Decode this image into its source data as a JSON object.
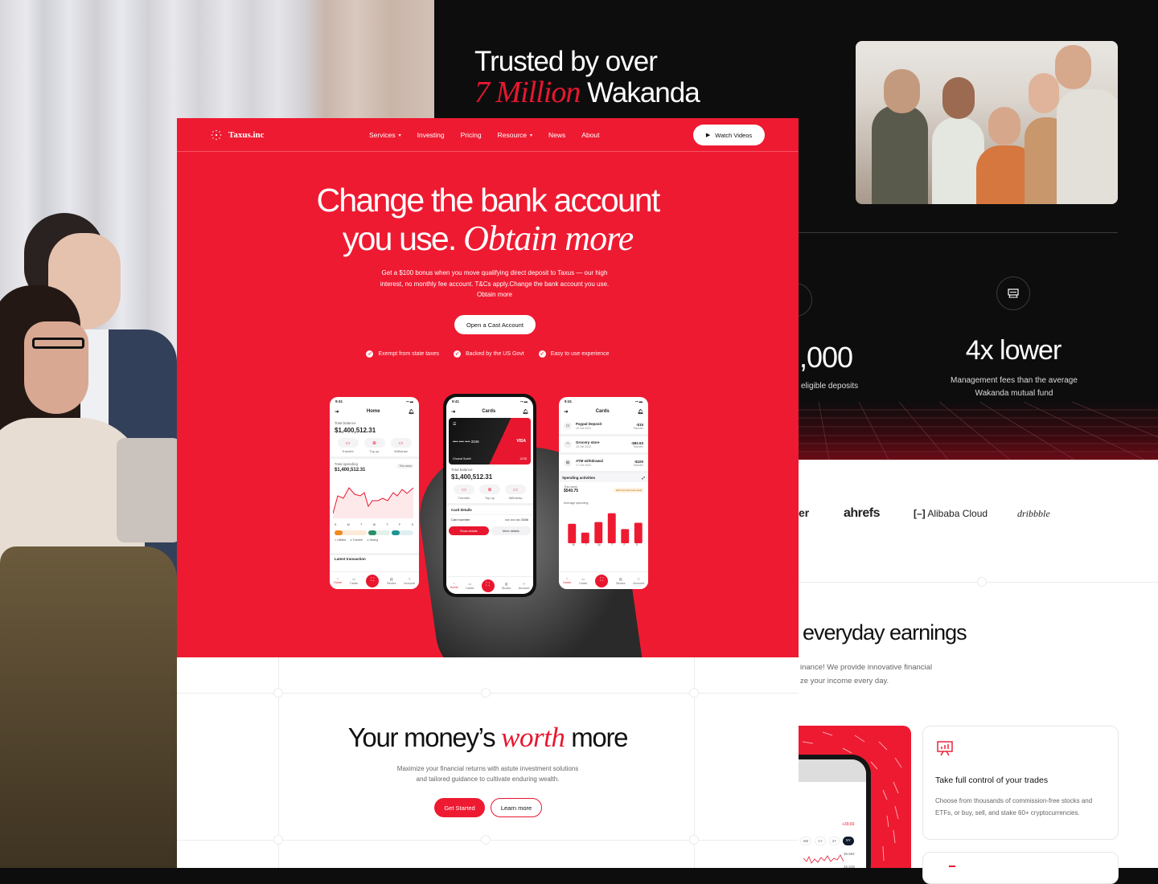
{
  "background_panels": {
    "dark": {
      "trusted_line1": "Trusted by over",
      "trusted_highlight": "7 Million",
      "trusted_line2_rest": "Wakanda",
      "team_photo_alt": "group-of-friends-celebrating",
      "stats": [
        {
          "value": ",000",
          "caption": "eligible deposits",
          "icon": "wallet-icon"
        },
        {
          "value": "4x lower",
          "caption_line1": "Management fees than the average",
          "caption_line2": "Wakanda mutual fund",
          "icon": "cash-register-icon"
        }
      ]
    },
    "white": {
      "partner_logos": [
        "er",
        "ahrefs",
        "Alibaba Cloud",
        "dribbble"
      ],
      "earnings_title": "everyday earnings",
      "earnings_sub_line1": "inance! We provide innovative financial",
      "earnings_sub_line2": "ze your income every day.",
      "trade_card": {
        "icon": "presentation-chart-icon",
        "title": "Take full control of your trades",
        "body": "Choose from thousands of commission-free stocks and ETFs, or buy, sell, and stake 60+ cryptocurrencies."
      },
      "phone_snippet": {
        "change": "+39,60",
        "ranges": [
          "6M",
          "1Y",
          "2Y",
          "5Y"
        ],
        "active_range": "5Y",
        "levels": [
          "36.682",
          "32.219"
        ]
      }
    }
  },
  "site": {
    "brand": "Taxus.inc",
    "nav": [
      {
        "label": "Services",
        "dropdown": true
      },
      {
        "label": "Investing",
        "dropdown": false
      },
      {
        "label": "Pricing",
        "dropdown": false
      },
      {
        "label": "Resource",
        "dropdown": true
      },
      {
        "label": "News",
        "dropdown": false
      },
      {
        "label": "About",
        "dropdown": false
      }
    ],
    "watch_button": "Watch Videos",
    "hero": {
      "title_line1": "Change the bank account",
      "title_line2_plain": "you use.",
      "title_line2_italic": "Obtain more",
      "subtitle": "Get a $100 bonus when you move qualifying direct deposit to Taxus — our high interest, no monthly fee account. T&Cs apply.Change the bank account you use. Obtain more",
      "cta": "Open a Cast Account",
      "checks": [
        "Exempt from state taxes",
        "Backed by the US Govt",
        "Easy to use experience"
      ]
    },
    "phones": {
      "time": "9:41",
      "home": {
        "title": "Home",
        "total_balance_label": "Total balance",
        "total_balance": "$1,400,512.31",
        "actions": [
          "Transfer",
          "Top up",
          "Withdraw"
        ],
        "spending_label": "Total spending",
        "spending_value": "$1,400,512.31",
        "period": "This week",
        "days": [
          "S",
          "M",
          "T",
          "W",
          "T",
          "F",
          "S"
        ],
        "legend": [
          "Utilities",
          "Transfer",
          "Saving"
        ],
        "latest": "Latest transaction"
      },
      "cards": {
        "title": "Cards",
        "card_number": "•••• •••• •••• 3346",
        "card_holder": "Chomal Suehli",
        "card_expiry": "12/28",
        "card_brand": "VISA",
        "total_balance_label": "Total balance",
        "total_balance": "$1,400,512.31",
        "actions": [
          "Transfer",
          "Top up",
          "Withdraw"
        ],
        "details_label": "Card details",
        "card_number_label": "Card number",
        "card_number_short": "•••• •••• •••• 3346",
        "show_details": "Show details",
        "more_details": "More details"
      },
      "activity": {
        "title": "Cards",
        "transactions": [
          {
            "name": "Paypal Deposit",
            "date": "15 Oct 2022",
            "amount": "-$15",
            "type": "Transfer"
          },
          {
            "name": "Grocery store",
            "date": "15 Oct 2022",
            "amount": "-$82.53",
            "type": "Transfer"
          },
          {
            "name": "ATM withdrawal",
            "date": "17 Oct 2022",
            "amount": "-$100",
            "type": "Transfer"
          }
        ],
        "spending_activities": "Spending activities",
        "this_week_label": "This week",
        "this_week_value": "$540.75",
        "badge": "20% less than last week",
        "avg_label": "Average spending",
        "bar_days": [
          "M",
          "T",
          "W",
          "T",
          "F",
          "S"
        ],
        "bar_values": [
          0.55,
          0.3,
          0.6,
          0.85,
          0.4,
          0.58
        ]
      },
      "tabbar": [
        "Home",
        "Cards",
        "",
        "Stocks",
        "Account"
      ]
    },
    "worth": {
      "title_plain1": "Your money’s",
      "title_italic": "worth",
      "title_plain2": "more",
      "subtitle_line1": "Maximize your financial returns with astute investment solutions",
      "subtitle_line2": "and tailored guidance to cultivate enduring wealth.",
      "primary": "Get Started",
      "secondary": "Learn more"
    }
  },
  "colors": {
    "brand_red": "#ee1a31",
    "dark_bg": "#0d0d0e"
  }
}
